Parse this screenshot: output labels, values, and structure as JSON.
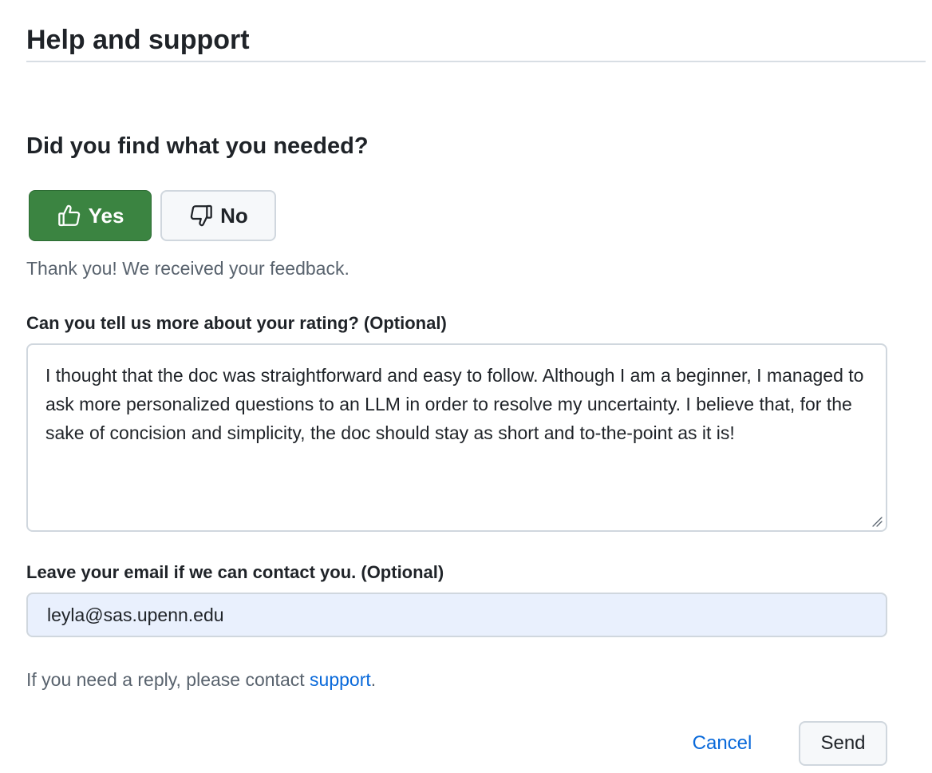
{
  "header": {
    "title": "Help and support"
  },
  "feedback": {
    "question": "Did you find what you needed?",
    "yes_label": "Yes",
    "no_label": "No",
    "selected": "Yes",
    "yes_icon": "thumbs-up-icon",
    "no_icon": "thumbs-down-icon",
    "confirmation": "Thank you! We received your feedback."
  },
  "comment": {
    "label": "Can you tell us more about your rating? (Optional)",
    "value": "I thought that the doc was straightforward and easy to follow. Although I am a beginner, I managed to ask more personalized questions to an LLM in order to resolve my uncertainty. I believe that, for the sake of concision and simplicity, the doc should stay as short and to-the-point as it is!"
  },
  "email": {
    "label": "Leave your email if we can contact you. (Optional)",
    "value": "leyla@sas.upenn.edu"
  },
  "reply_note": {
    "prefix": "If you need a reply, please contact ",
    "link_text": "support",
    "suffix": "."
  },
  "actions": {
    "cancel_label": "Cancel",
    "send_label": "Send"
  },
  "colors": {
    "yes_selected_bg": "#3b8441",
    "link": "#0969da",
    "muted_text": "#59636e",
    "autofill_bg": "#e9f0fd"
  }
}
